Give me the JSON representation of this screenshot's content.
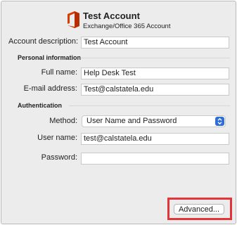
{
  "account": {
    "name": "Test Account",
    "type": "Exchange/Office 365 Account",
    "logo_icon": "office-365-icon",
    "logo_color": "#d83b01"
  },
  "form": {
    "description_label": "Account description:",
    "description_value": "Test Account",
    "personal_section": "Personal information",
    "full_name_label": "Full name:",
    "full_name_value": "Help Desk Test",
    "email_label": "E-mail address:",
    "email_value": "Test@calstatela.edu",
    "auth_section": "Authentication",
    "method_label": "Method:",
    "method_value": "User Name and Password",
    "username_label": "User name:",
    "username_value": "test@calstatela.edu",
    "password_label": "Password:",
    "password_value": ""
  },
  "footer": {
    "advanced_label": "Advanced...",
    "highlight_color": "#e3343a"
  }
}
